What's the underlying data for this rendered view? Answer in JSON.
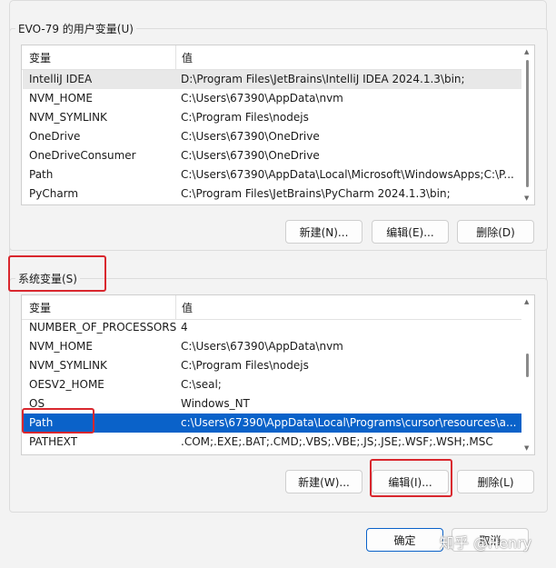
{
  "user_group": {
    "title": "EVO-79 的用户变量(U)",
    "col_var": "变量",
    "col_val": "值",
    "rows": [
      {
        "name": "IntelliJ IDEA",
        "value": "D:\\Program Files\\JetBrains\\IntelliJ IDEA 2024.1.3\\bin;"
      },
      {
        "name": "NVM_HOME",
        "value": "C:\\Users\\67390\\AppData\\nvm"
      },
      {
        "name": "NVM_SYMLINK",
        "value": "C:\\Program Files\\nodejs"
      },
      {
        "name": "OneDrive",
        "value": "C:\\Users\\67390\\OneDrive"
      },
      {
        "name": "OneDriveConsumer",
        "value": "C:\\Users\\67390\\OneDrive"
      },
      {
        "name": "Path",
        "value": "C:\\Users\\67390\\AppData\\Local\\Microsoft\\WindowsApps;C:\\P..."
      },
      {
        "name": "PyCharm",
        "value": "C:\\Program Files\\JetBrains\\PyCharm 2024.1.3\\bin;"
      }
    ],
    "btn_new": "新建(N)...",
    "btn_edit": "编辑(E)...",
    "btn_delete": "删除(D)"
  },
  "system_group": {
    "title": "系统变量(S)",
    "col_var": "变量",
    "col_val": "值",
    "rows": [
      {
        "name": "NUMBER_OF_PROCESSORS",
        "value": "4"
      },
      {
        "name": "NVM_HOME",
        "value": "C:\\Users\\67390\\AppData\\nvm"
      },
      {
        "name": "NVM_SYMLINK",
        "value": "C:\\Program Files\\nodejs"
      },
      {
        "name": "OESV2_HOME",
        "value": "C:\\seal;"
      },
      {
        "name": "OS",
        "value": "Windows_NT"
      },
      {
        "name": "Path",
        "value": "c:\\Users\\67390\\AppData\\Local\\Programs\\cursor\\resources\\a..."
      },
      {
        "name": "PATHEXT",
        "value": ".COM;.EXE;.BAT;.CMD;.VBS;.VBE;.JS;.JSE;.WSF;.WSH;.MSC"
      }
    ],
    "btn_new": "新建(W)...",
    "btn_edit": "编辑(I)...",
    "btn_delete": "删除(L)"
  },
  "footer": {
    "ok": "确定",
    "cancel": "取消"
  },
  "watermark": "知乎 @Henry",
  "colors": {
    "selection": "#0a62c9",
    "highlight_box": "#d9272e"
  }
}
